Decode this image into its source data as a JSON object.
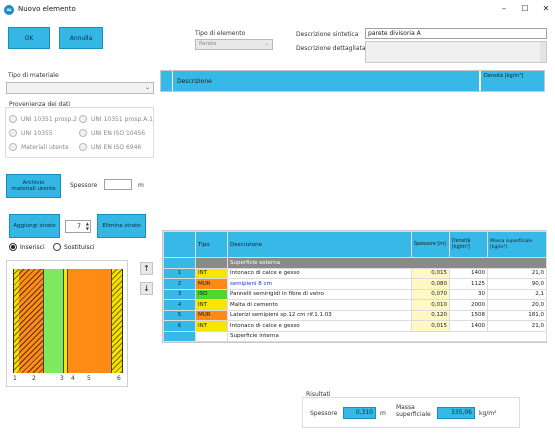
{
  "window": {
    "title": "Nuovo elemento",
    "icon": "app-logo-icon",
    "controls": [
      "–",
      "☐",
      "✕"
    ]
  },
  "buttons": {
    "ok": "OK",
    "annulla": "Annulla",
    "archivio": "Archivio materiali utente",
    "aggiungi": "Aggiungi strato",
    "elimina": "Elimina strato"
  },
  "tipo_elemento": {
    "label": "Tipo di elemento",
    "value": "Parete"
  },
  "descrizione_sintetica": {
    "label": "Descrizione sintetica",
    "value": "parete divisoria A"
  },
  "descrizione_dettagliata": {
    "label": "Descrizione dettagliata",
    "value": ""
  },
  "tipo_materiale": {
    "label": "Tipo di materiale",
    "value": ""
  },
  "provenienza": {
    "label": "Provenienza dei dati",
    "options": [
      "UNI 10351 prosp.2",
      "UNI 10351 prosp.A.1",
      "UNI 10355",
      "UNI EN ISO 10456",
      "Materiali utente",
      "UNI EN ISO 6946"
    ]
  },
  "material_grid": {
    "col_descrizione": "Descrizione",
    "col_densita": "Densità [kg/m³]"
  },
  "spessore": {
    "label": "Spessore",
    "value": "",
    "unit": "m"
  },
  "stepper": {
    "value": "7"
  },
  "mode": {
    "inserisci": "Inserisci",
    "sostituisci": "Sostituisci",
    "selected": "inserisci"
  },
  "arrows": {
    "up": "↑",
    "down": "↓"
  },
  "layer_grid": {
    "headers": {
      "tipo": "Tipo",
      "descrizione": "Descrizione",
      "spessore": "Spessore [m]",
      "densita": "Densità [kg/m³]",
      "massa": "Massa superficiale [kg/m²]"
    },
    "surface_external": "Superficie esterna",
    "surface_internal": "Superficie interna",
    "rows": [
      {
        "n": "1",
        "tipo": "INT",
        "descrizione": "Intonaco di calce e gesso",
        "spessore": "0,015",
        "densita": "1400",
        "massa": "21,0"
      },
      {
        "n": "2",
        "tipo": "MUR",
        "descrizione": "semipieni 8 cm",
        "spessore": "0,080",
        "densita": "1125",
        "massa": "90,0"
      },
      {
        "n": "3",
        "tipo": "ISO",
        "descrizione": "Pannelli semirigidi in fibre di vetro",
        "spessore": "0,070",
        "densita": "30",
        "massa": "2,1"
      },
      {
        "n": "4",
        "tipo": "INT",
        "descrizione": "Malta di cemento",
        "spessore": "0,010",
        "densita": "2000",
        "massa": "20,0"
      },
      {
        "n": "5",
        "tipo": "MUR",
        "descrizione": "Laterizi semipieni sp.12 cm rif.1.1.03",
        "spessore": "0,120",
        "densita": "1508",
        "massa": "181,0"
      },
      {
        "n": "6",
        "tipo": "INT",
        "descrizione": "Intonaco di calce e gesso",
        "spessore": "0,015",
        "densita": "1400",
        "massa": "21,0"
      }
    ]
  },
  "wall_preview": {
    "layer_labels": [
      "1",
      "2",
      "3",
      "4",
      "5",
      "6"
    ],
    "colors": {
      "int": "#f7e400",
      "mur": "#ff8a14",
      "iso": "#7ee85e"
    }
  },
  "risultati": {
    "label": "Risultati",
    "spessore_label": "Spessore",
    "spessore_value": "0,310",
    "spessore_unit": "m",
    "massa_label": "Massa superficiale",
    "massa_value": "335,06",
    "massa_unit": "kg/m²"
  }
}
